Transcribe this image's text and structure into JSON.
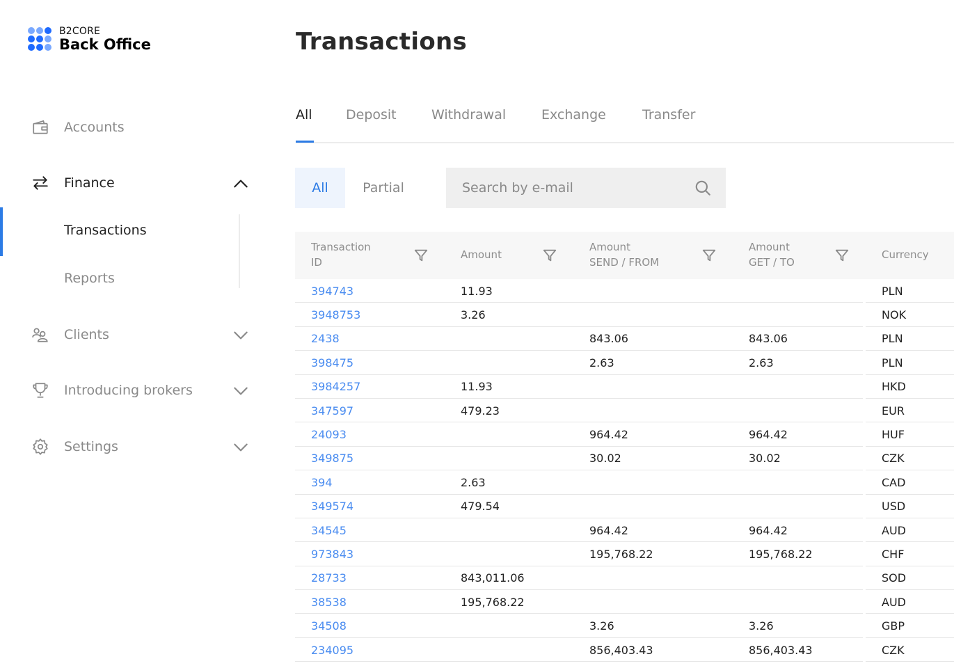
{
  "brand": {
    "small": "B2CORE",
    "big": "Back Office"
  },
  "sidebar": {
    "items": [
      {
        "label": "Accounts",
        "icon": "wallet-icon"
      },
      {
        "label": "Finance",
        "icon": "exchange-arrows-icon",
        "expanded": true
      },
      {
        "label": "Clients",
        "icon": "users-icon"
      },
      {
        "label": "Introducing brokers",
        "icon": "trophy-icon"
      },
      {
        "label": "Settings",
        "icon": "gear-icon"
      }
    ],
    "finance_sub": [
      "Transactions",
      "Reports"
    ]
  },
  "page": {
    "title": "Transactions"
  },
  "tabs": [
    "All",
    "Deposit",
    "Withdrawal",
    "Exchange",
    "Transfer"
  ],
  "segments": [
    "All",
    "Partial"
  ],
  "search": {
    "placeholder": "Search by e-mail"
  },
  "table": {
    "headers": {
      "id": [
        "Transaction",
        "ID"
      ],
      "amount": "Amount",
      "send": [
        "Amount",
        "SEND / FROM"
      ],
      "get": [
        "Amount",
        "GET / TO"
      ],
      "currency": "Currency"
    },
    "rows": [
      {
        "id": "394743",
        "amount": "11.93",
        "send": "",
        "get": "",
        "currency": "PLN"
      },
      {
        "id": "3948753",
        "amount": "3.26",
        "send": "",
        "get": "",
        "currency": "NOK"
      },
      {
        "id": "2438",
        "amount": "",
        "send": "843.06",
        "get": "843.06",
        "currency": "PLN"
      },
      {
        "id": "398475",
        "amount": "",
        "send": "2.63",
        "get": "2.63",
        "currency": "PLN"
      },
      {
        "id": "3984257",
        "amount": "11.93",
        "send": "",
        "get": "",
        "currency": "HKD"
      },
      {
        "id": "347597",
        "amount": "479.23",
        "send": "",
        "get": "",
        "currency": "EUR"
      },
      {
        "id": "24093",
        "amount": "",
        "send": "964.42",
        "get": "964.42",
        "currency": "HUF"
      },
      {
        "id": "349875",
        "amount": "",
        "send": "30.02",
        "get": "30.02",
        "currency": "CZK"
      },
      {
        "id": "394",
        "amount": "2.63",
        "send": "",
        "get": "",
        "currency": "CAD"
      },
      {
        "id": "349574",
        "amount": "479.54",
        "send": "",
        "get": "",
        "currency": "USD"
      },
      {
        "id": "34545",
        "amount": "",
        "send": "964.42",
        "get": "964.42",
        "currency": "AUD"
      },
      {
        "id": "973843",
        "amount": "",
        "send": "195,768.22",
        "get": "195,768.22",
        "currency": "CHF"
      },
      {
        "id": "28733",
        "amount": "843,011.06",
        "send": "",
        "get": "",
        "currency": "SOD"
      },
      {
        "id": "38538",
        "amount": "195,768.22",
        "send": "",
        "get": "",
        "currency": "AUD"
      },
      {
        "id": "34508",
        "amount": "",
        "send": "3.26",
        "get": "3.26",
        "currency": "GBP"
      },
      {
        "id": "234095",
        "amount": "",
        "send": "856,403.43",
        "get": "856,403.43",
        "currency": "CZK"
      }
    ]
  },
  "colors": {
    "accent": "#2c7be5",
    "link": "#4a8cf0",
    "muted": "#8a8a8a"
  }
}
